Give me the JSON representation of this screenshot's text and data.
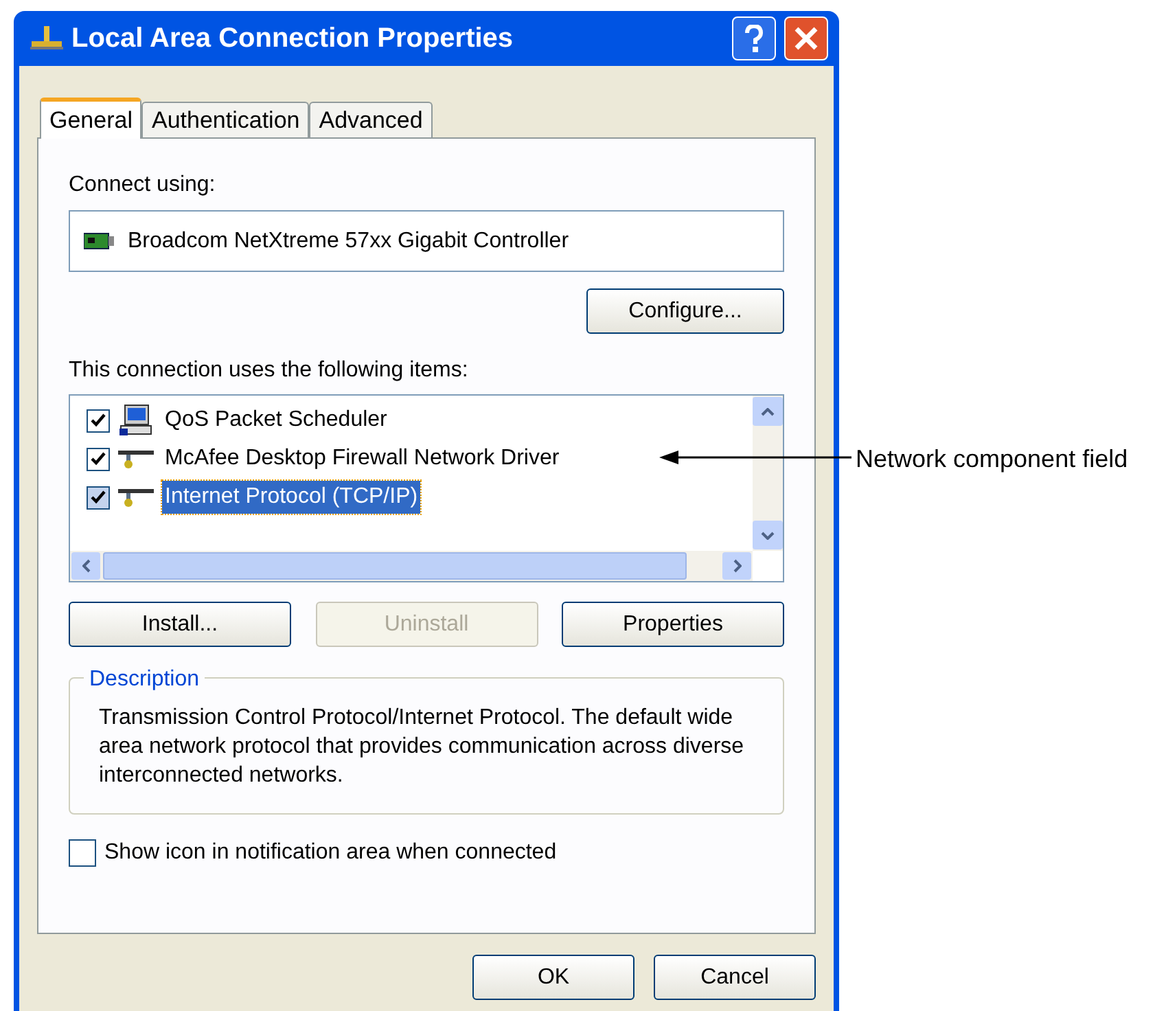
{
  "window": {
    "title": "Local Area Connection Properties"
  },
  "tabs": [
    {
      "label": "General",
      "selected": true
    },
    {
      "label": "Authentication",
      "selected": false
    },
    {
      "label": "Advanced",
      "selected": false
    }
  ],
  "connect_using": {
    "label": "Connect using:",
    "adapter": "Broadcom NetXtreme 57xx Gigabit Controller"
  },
  "configure_button": "Configure...",
  "items_label": "This connection uses the following items:",
  "items": [
    {
      "name": "QoS Packet Scheduler",
      "checked": true,
      "selected": false,
      "kind": "service"
    },
    {
      "name": "McAfee Desktop Firewall Network Driver",
      "checked": true,
      "selected": false,
      "kind": "protocol"
    },
    {
      "name": "Internet Protocol (TCP/IP)",
      "checked": true,
      "selected": true,
      "kind": "protocol"
    }
  ],
  "buttons": [
    {
      "label": "Install...",
      "disabled": false
    },
    {
      "label": "Uninstall",
      "disabled": true
    },
    {
      "label": "Properties",
      "disabled": false
    }
  ],
  "description": {
    "title": "Description",
    "text": "Transmission Control Protocol/Internet Protocol. The default wide area network protocol that provides communication across diverse interconnected networks."
  },
  "show_icon": {
    "label": "Show icon in notification area when connected",
    "checked": false
  },
  "dialog_buttons": [
    "OK",
    "Cancel"
  ],
  "callout": {
    "label": "Network component field"
  }
}
